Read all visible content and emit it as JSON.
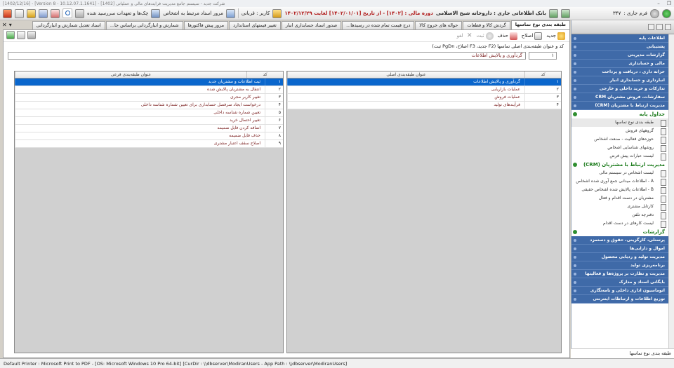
{
  "window": {
    "title": "[1402/12/16] - [Version 8 - 10.12.07.1.1641] - [1402] شرکت جدید - سیستم جامع مدیریت فرآیندهای مالی و عملیاتی"
  },
  "toolbar": {
    "form_label": "فرم جاری :",
    "form_number": "۳۴۷",
    "app_name": "بانک اطلاعاتی جاری : داروخانه شیخ الاسلامی",
    "fiscal_period": "دوره مالی : [۱۴۰۲] - از تاریخ [۱۴۰۲/۰۱/۰۱] لغایت ۱۴۰۲/۱۲/۲۹",
    "user_label": "کاربر : قربانی",
    "linked_docs": "مرور اسناد مرتبط به اشخاص",
    "checks_due": "چک‌ها و تعهدات سررسید شده"
  },
  "tabs": [
    {
      "label": "طبقه بندی نوع تماسها",
      "active": true
    },
    {
      "label": "گردش کالا و قطعات",
      "active": false
    },
    {
      "label": "حواله های خروج کالا",
      "active": false
    },
    {
      "label": "درج قیمت تمام شده در رسیدها...",
      "active": false
    },
    {
      "label": "صدور اسناد حسابداری انبار",
      "active": false
    },
    {
      "label": "تغییر قیمتهای استاندارد",
      "active": false
    },
    {
      "label": "مرور پیش فاکتورها",
      "active": false
    },
    {
      "label": "شمارش و انبارگردانی براساس جا...",
      "active": false
    },
    {
      "label": "اسناد تعدیل شمارش و انبارگردانی",
      "active": false
    }
  ],
  "actions": {
    "new": "جدید",
    "edit": "اصلاح",
    "delete": "حذف",
    "save": "ثبت",
    "cancel": "لغو"
  },
  "hint": "کد و عنوان طبقه‌بندی اصلی تماسها   (F2  جدید،   F3  اصلاح،   PgDn  ثبت)",
  "form": {
    "code": "۱",
    "title": "گردآوری و پالایش اطلاعات"
  },
  "main_grid": {
    "col_code": "کد",
    "col_title": "عنوان طبقه‌بندی اصلی",
    "rows": [
      {
        "code": "۱",
        "title": "گردآوری و پالایش اطلاعات",
        "selected": true
      },
      {
        "code": "۲",
        "title": "عملیات بازاریابی",
        "selected": false
      },
      {
        "code": "۳",
        "title": "عملیات فروش",
        "selected": false
      },
      {
        "code": "۴",
        "title": "فرآیندهای تولید",
        "selected": false
      }
    ]
  },
  "sub_grid": {
    "col_code": "کد",
    "col_title": "عنوان طبقه‌بندی فرعی",
    "rows": [
      {
        "code": "۱",
        "title": "ثبت اطلاعات و مشتریان جدید",
        "selected": true
      },
      {
        "code": "۲",
        "title": "انتقال به مشتریان پالایش شده",
        "selected": false
      },
      {
        "code": "۳",
        "title": "تغییر کاربر مجری",
        "selected": false
      },
      {
        "code": "۴",
        "title": "درخواست ایجاد سرفصل حسابداری برای تعیین شماره شناسه داخلی",
        "selected": false
      },
      {
        "code": "۵",
        "title": "تعیین شماره شناسه داخلی",
        "selected": false
      },
      {
        "code": "۶",
        "title": "تغییر احتمال خرید",
        "selected": false
      },
      {
        "code": "۷",
        "title": "اضافه کردن فایل ضمیمه",
        "selected": false
      },
      {
        "code": "۸",
        "title": "حذف فایل ضمیمه",
        "selected": false
      },
      {
        "code": "۹",
        "title": "اصلاح سقف اعتبار مشتری",
        "selected": false
      }
    ]
  },
  "sidebar": {
    "top_items": [
      "اطلاعات پایه",
      "پشتیبانی",
      "گزارشات مدیریتی",
      "مالی و حسابداری",
      "خزانه داری ، دریافت و پرداخت",
      "انبارداری و حسابداری انبار",
      "تدارکات و خرید داخلی و خارجی",
      "سفارشات، فروش مشتریان CRM",
      "مدیریت ارتباط با مشتریان (CRM)"
    ],
    "group_base": "جداول پایه",
    "base_items": [
      {
        "label": "طبقه بندی نوع تماسها",
        "selected": true
      },
      {
        "label": "گروههای فروش",
        "selected": false
      },
      {
        "label": "حوزه‌های فعالیت - صنعت اشخاص",
        "selected": false
      },
      {
        "label": "روشهای شناسایی اشخاص",
        "selected": false
      },
      {
        "label": "لیست عبارات پیش فرض",
        "selected": false
      }
    ],
    "group_crm": "مدیریت ارتباط با مشتریان (CRM)",
    "crm_items": [
      "لیست اشخاص در سیستم مالی",
      "A - اطلاعات میدانی جمع آوری شده اشخاص",
      "B - اطلاعات پالایش شده اشخاص حقیقی",
      "مشتریان در دست اقدام و فعال",
      "کارتابل مشتری",
      "دفترچه تلفن",
      "لیست کارهای در دست اقدام"
    ],
    "group_reports": "گزارشات",
    "bottom_items": [
      "پرسنلی، کارگزینی، حقوق و دستمزد",
      "اموال و دارایی‌ها",
      "مدیریت تولید و ردیابی محصول",
      "برنامه‌ریزی تولید",
      "مدیریت و نظارت بر پروژه‌ها و فعالیتها",
      "بایگانی اسناد و مدارک",
      "اتوماسیون اداری داخلی و نامه‌نگاری",
      "توزیع اطلاعات و ارتباطات اینترنتی"
    ],
    "footer_text": "طبقه بندی نوع تماسها"
  },
  "status": {
    "printer": "Default Printer : Microsoft Print to PDF - [OS: Microsoft Windows 10 Pro 64-bit]  [CurDir : \\\\dbserver\\ModiranUsers - App Path : \\\\dbserver\\ModiranUsers]"
  },
  "colors": {
    "accent": "#0a66cc",
    "sidebar_blue": "#3f6aa8",
    "group_green": "#1a7a1a",
    "row_text": "#7a1e1e"
  }
}
